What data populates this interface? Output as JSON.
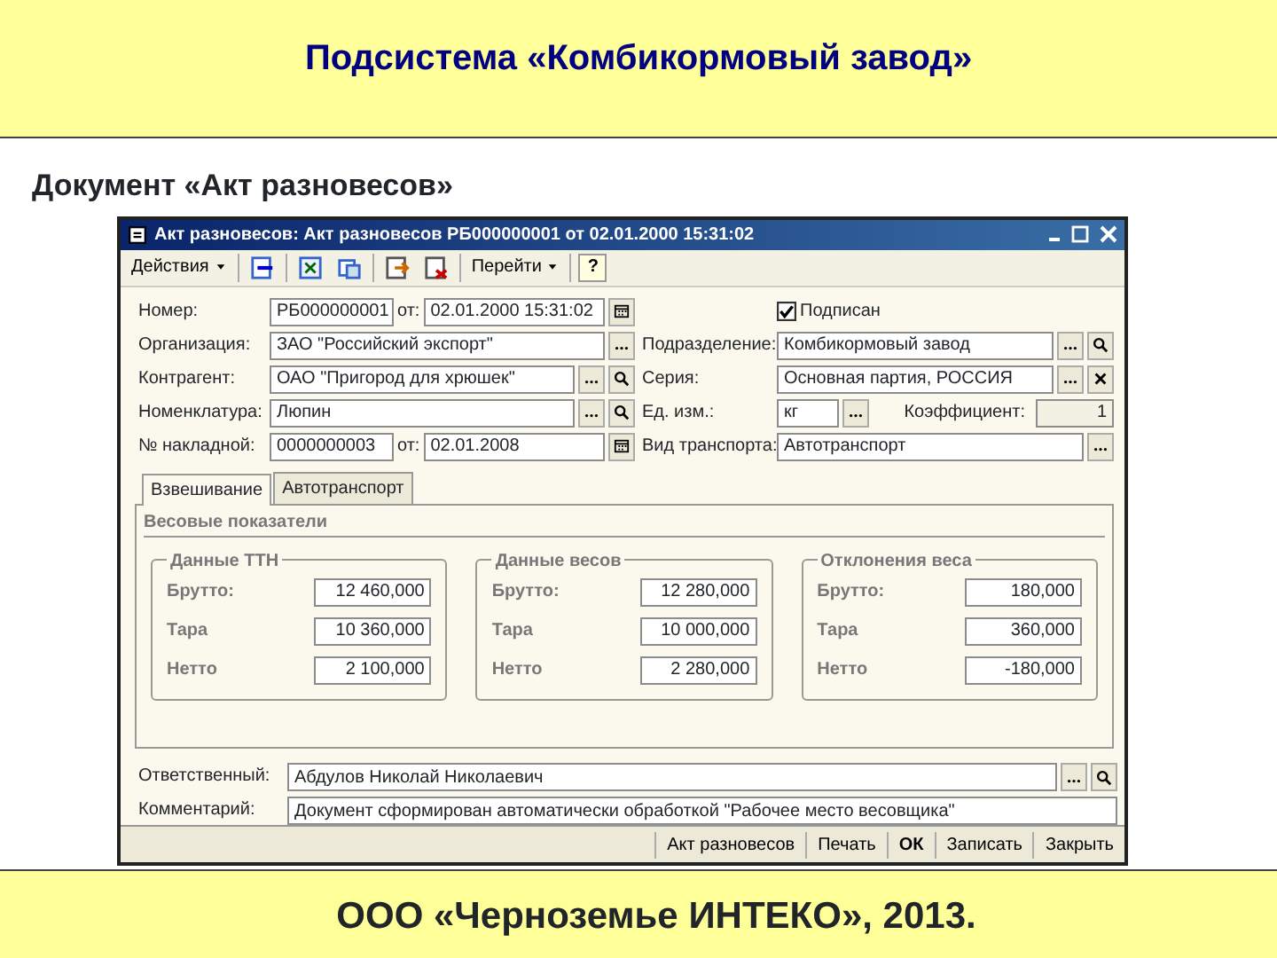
{
  "slide_title": "Подсистема «Комбикормовый завод»",
  "subtitle": "Документ «Акт разновесов»",
  "window": {
    "title": "Акт разновесов: Акт разновесов РБ000000001 от 02.01.2000 15:31:02",
    "toolbar": [
      {
        "kind": "menu",
        "label": "Действия"
      },
      {
        "kind": "sep"
      },
      {
        "kind": "icon"
      },
      {
        "kind": "sep"
      },
      {
        "kind": "icon"
      },
      {
        "kind": "icon"
      },
      {
        "kind": "sep"
      },
      {
        "kind": "icon"
      },
      {
        "kind": "icon"
      },
      {
        "kind": "sep"
      },
      {
        "kind": "menu",
        "label": "Перейти"
      },
      {
        "kind": "sep"
      },
      {
        "kind": "help",
        "label": "?"
      }
    ],
    "rows": [
      {
        "left": {
          "kind": "doc",
          "label": "Номер:",
          "value": "РБ000000001",
          "date_label": "от:",
          "date": "02.01.2000 15:31:02"
        },
        "right": {
          "kind": "checkbox",
          "label": "Подписан",
          "checked": true
        }
      },
      {
        "left": {
          "kind": "ref",
          "label": "Организация:",
          "value": "ЗАО \"Российский экспорт\"",
          "select_button": true
        },
        "right": {
          "kind": "ref",
          "label": "Подразделение:",
          "value": "Комбикормовый завод",
          "select_button": true,
          "search_button": true
        }
      },
      {
        "left": {
          "kind": "ref",
          "label": "Контрагент:",
          "value": "ОАО \"Пригород для хрюшек\"",
          "select_button": true,
          "search_button": true
        },
        "right": {
          "kind": "ref",
          "label": "Серия:",
          "value": "Основная партия, РОССИЯ",
          "select_button": true,
          "clear_button": true
        }
      },
      {
        "left": {
          "kind": "ref",
          "label": "Номенклатура:",
          "value": "Люпин",
          "select_button": true,
          "search_button": true
        },
        "right": {
          "kind": "unit",
          "label": "Ед. изм.:",
          "value": "кг",
          "select_button": true,
          "coef_label": "Коэффициент:",
          "coef": "1"
        }
      },
      {
        "left": {
          "kind": "doc",
          "label": "№ накладной:",
          "value": "0000000003",
          "date_label": "от:",
          "date": "02.01.2008"
        },
        "right": {
          "kind": "ref",
          "label": "Вид транспорта:",
          "value": "Автотранспорт",
          "select_button": true
        }
      }
    ],
    "tabs": [
      {
        "label": "Взвешивание",
        "selected": true
      },
      {
        "label": "Автотранспорт",
        "selected": false
      }
    ],
    "panel_title": "Весовые показатели",
    "groups": [
      {
        "title": "Данные ТТН",
        "rows": [
          {
            "label": "Брутто:",
            "value": "12 460,000"
          },
          {
            "label": "Тара",
            "value": "10 360,000"
          },
          {
            "label": "Нетто",
            "value": "2 100,000"
          }
        ]
      },
      {
        "title": "Данные весов",
        "rows": [
          {
            "label": "Брутто:",
            "value": "12 280,000"
          },
          {
            "label": "Тара",
            "value": "10 000,000"
          },
          {
            "label": "Нетто",
            "value": "2 280,000"
          }
        ]
      },
      {
        "title": "Отклонения веса",
        "rows": [
          {
            "label": "Брутто:",
            "value": "180,000"
          },
          {
            "label": "Тара",
            "value": "360,000"
          },
          {
            "label": "Нетто",
            "value": "-180,000"
          }
        ]
      }
    ],
    "bottom_fields": [
      {
        "label": "Ответственный:",
        "value": "Абдулов Николай Николаевич",
        "select_button": true,
        "search_button": true
      },
      {
        "label": "Комментарий:",
        "value": "Документ сформирован автоматически обработкой \"Рабочее место весовщика\""
      }
    ],
    "buttons": [
      {
        "label": "Акт разновесов",
        "default": false
      },
      {
        "label": "Печать",
        "default": false
      },
      {
        "label": "ОК",
        "default": true
      },
      {
        "label": "Записать",
        "default": false
      },
      {
        "label": "Закрыть",
        "default": false
      }
    ]
  },
  "footer": "ООО «Черноземье ИНТЕКО», 2013."
}
